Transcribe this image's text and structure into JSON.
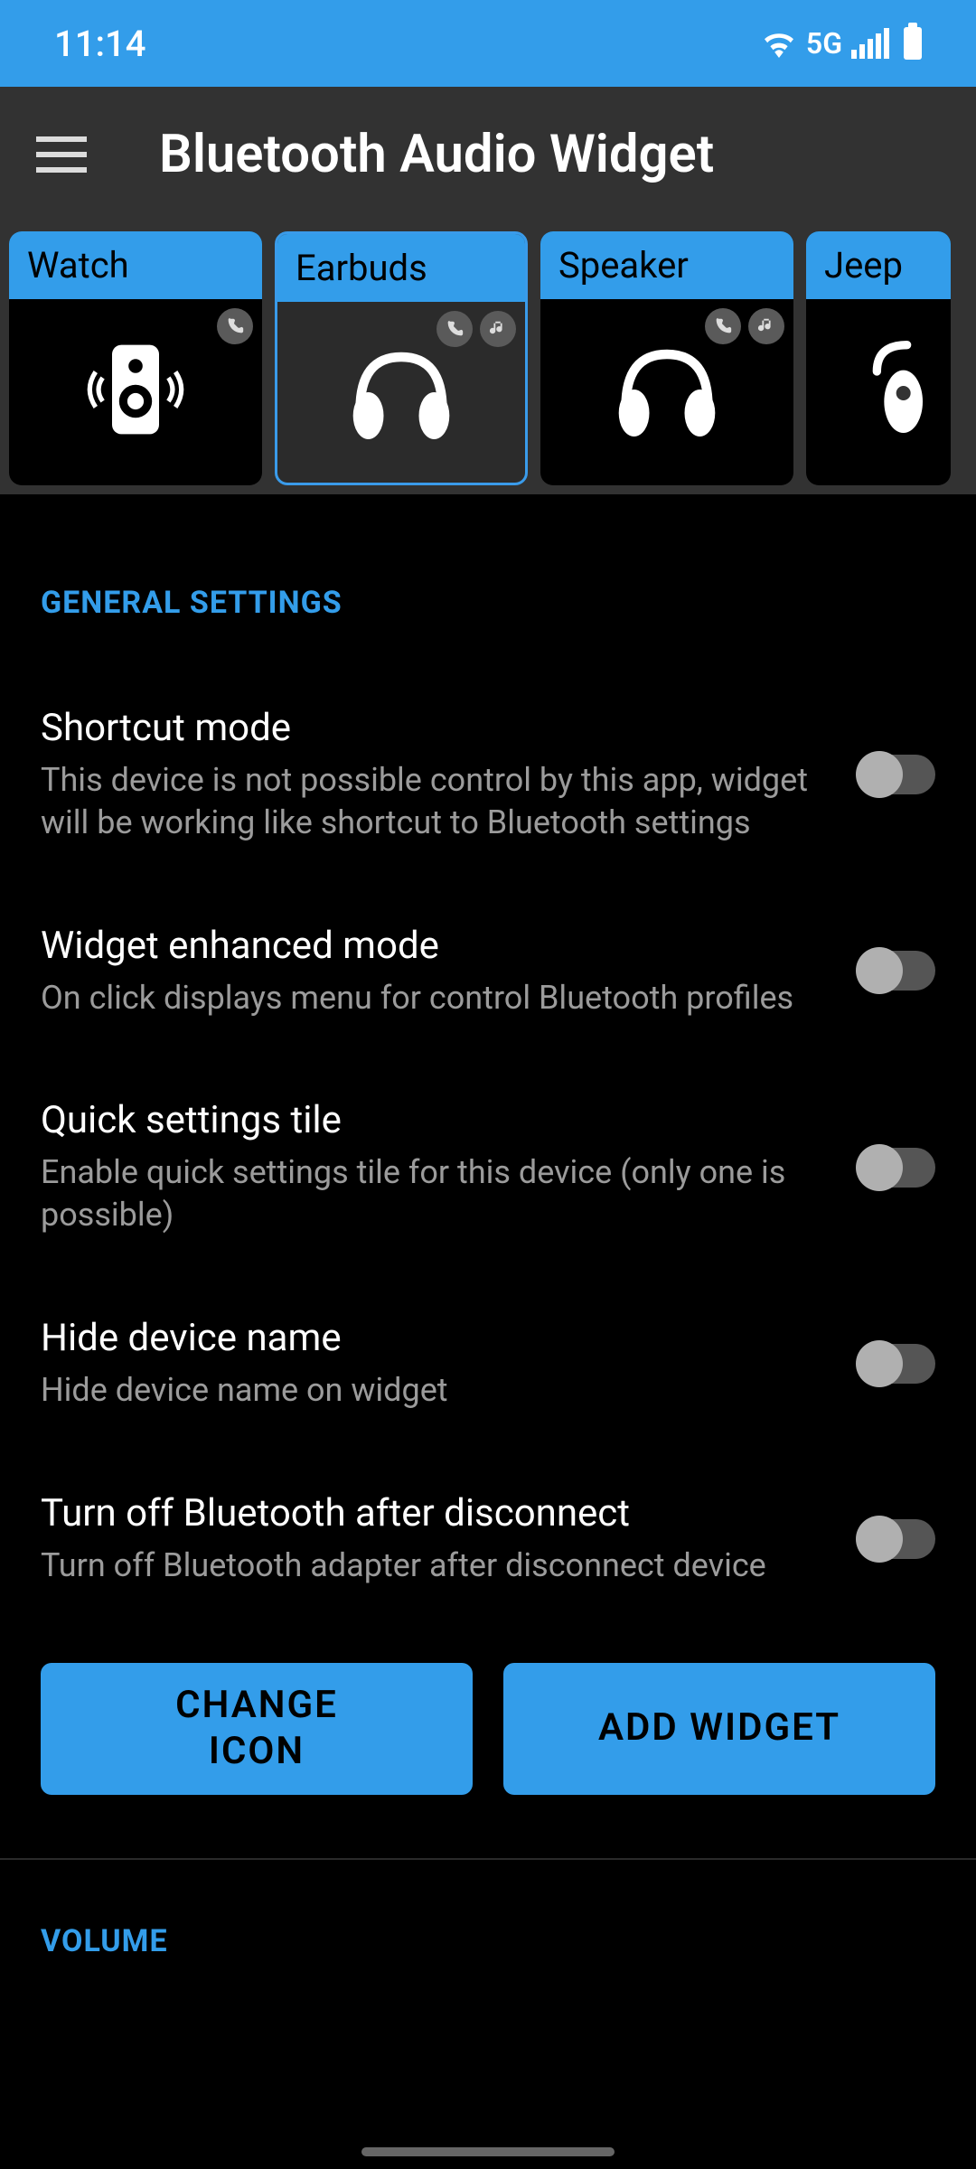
{
  "status": {
    "time": "11:14",
    "network": "5G"
  },
  "app": {
    "title": "Bluetooth Audio Widget"
  },
  "devices": [
    {
      "name": "Watch",
      "selected": false,
      "has_call": true,
      "has_music": false,
      "icon": "speaker"
    },
    {
      "name": "Earbuds",
      "selected": true,
      "has_call": true,
      "has_music": true,
      "icon": "headphones"
    },
    {
      "name": "Speaker",
      "selected": false,
      "has_call": true,
      "has_music": true,
      "icon": "headphones"
    },
    {
      "name": "Jeep",
      "selected": false,
      "has_call": true,
      "has_music": false,
      "icon": "headset"
    }
  ],
  "sections": {
    "general": {
      "header": "GENERAL SETTINGS",
      "items": [
        {
          "title": "Shortcut mode",
          "desc": "This device is not possible control by this app, widget will be working like shortcut to Bluetooth settings",
          "on": false
        },
        {
          "title": "Widget enhanced mode",
          "desc": "On click displays menu for control Bluetooth profiles",
          "on": false
        },
        {
          "title": "Quick settings tile",
          "desc": "Enable quick settings tile for this device (only one is possible)",
          "on": false
        },
        {
          "title": "Hide device name",
          "desc": "Hide device name on widget",
          "on": false
        },
        {
          "title": "Turn off Bluetooth after disconnect",
          "desc": "Turn off Bluetooth adapter after disconnect device",
          "on": false
        }
      ]
    },
    "volume": {
      "header": "VOLUME"
    }
  },
  "buttons": {
    "change_icon": "CHANGE ICON",
    "add_widget": "ADD WIDGET"
  }
}
